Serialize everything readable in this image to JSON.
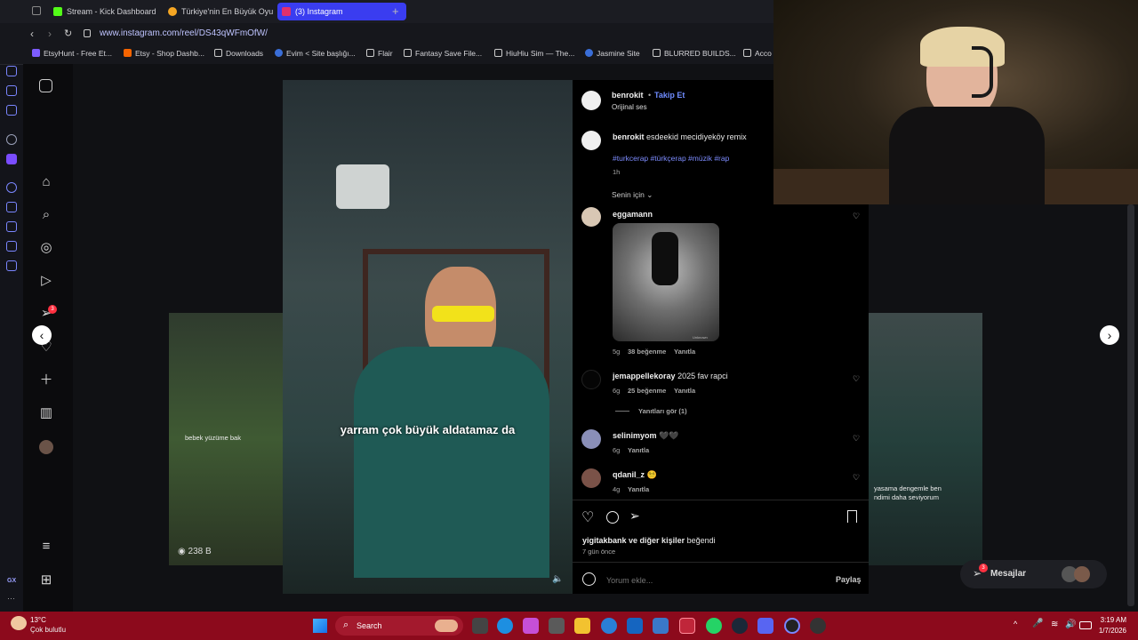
{
  "tabs": [
    {
      "label": "Stream - Kick Dashboard",
      "color": "#53fc18"
    },
    {
      "label": "Türkiye'nin En Büyük Oyu",
      "color": "#f5a623"
    },
    {
      "label": "(3) Instagram",
      "color": "#e1306c",
      "active": true
    }
  ],
  "address": {
    "url": "www.instagram.com/reel/DS43qWFmOfW/"
  },
  "bookmarks": [
    {
      "label": "EtsyHunt - Free Et...",
      "color": "#7d5cff"
    },
    {
      "label": "Etsy - Shop Dashb...",
      "color": "#f56400"
    },
    {
      "label": "Downloads",
      "color": "#cccccc"
    },
    {
      "label": "Evim < Site başlığı...",
      "color": "#3a6ed8"
    },
    {
      "label": "Flair",
      "color": "#cccccc"
    },
    {
      "label": "Fantasy Save File...",
      "color": "#cccccc"
    },
    {
      "label": "HiuHiu Sim — The...",
      "color": "#cccccc"
    },
    {
      "label": "Jasmine Site",
      "color": "#3a6ed8"
    },
    {
      "label": "BLURRED BUILDS...",
      "color": "#cccccc"
    },
    {
      "label": "Acco",
      "color": "#cccccc"
    }
  ],
  "nav": {
    "badge": "3"
  },
  "reel": {
    "caption": "yarram çok büyük aldatamaz da",
    "left_side_text": "bebek yüzüme bak",
    "left_views": "238 B",
    "right_side_text_1": "yasama dengemle ben",
    "right_side_text_2": "ndimi daha seviyorum"
  },
  "post": {
    "author": "benrokit",
    "follow": "Takip Et",
    "audio": "Orijinal ses",
    "caption_user": "benrokit",
    "caption_text": "esdeekid mecidiyeköy remix",
    "hashtags": "#turkcerap #türkçerap #müzik #rap",
    "caption_time": "1h",
    "sort": "Senin için"
  },
  "comments": [
    {
      "user": "eggamann",
      "text": "",
      "time": "5g",
      "likes": "38 beğenme",
      "reply": "Yanıtla",
      "image_text": "Unknown"
    },
    {
      "user": "jemappellekoray",
      "text": "2025 fav rapci",
      "time": "6g",
      "likes": "25 beğenme",
      "reply": "Yanıtla",
      "view_replies": "Yanıtları gör (1)"
    },
    {
      "user": "selinimyom",
      "text": "🖤🖤",
      "time": "6g",
      "reply": "Yanıtla"
    },
    {
      "user": "qdanil_z",
      "text": "😵‍💫",
      "time": "4g",
      "reply": "Yanıtla"
    }
  ],
  "likes_line": {
    "user": "yigitakbank",
    "rest": "ve diğer kişiler",
    "liked": "beğendi"
  },
  "posted_ago": "7 gün önce",
  "add_comment": {
    "placeholder": "Yorum ekle...",
    "share": "Paylaş"
  },
  "messages": {
    "label": "Mesajlar",
    "badge": "3"
  },
  "taskbar": {
    "temp": "13°C",
    "weather": "Çok bulutlu",
    "search": "Search",
    "time": "3:19 AM",
    "date": "1/7/2026"
  }
}
